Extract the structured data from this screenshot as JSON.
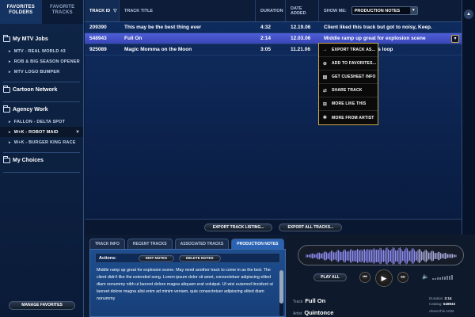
{
  "sidebar": {
    "tabs": [
      {
        "label": "FAVORITES FOLDERS"
      },
      {
        "label": "FAVORITE TRACKS"
      }
    ],
    "groups": [
      {
        "label": "My MTV Jobs",
        "items": [
          "MTV - REAL WORLD #3",
          "ROB & BIG SEASON OPENER",
          "MTV LOGO BUMPER"
        ]
      },
      {
        "label": "Cartoon Network",
        "items": []
      },
      {
        "label": "Agency Work",
        "items": [
          "FALLON - DELTA SPOT",
          "W+K - ROBOT MAID",
          "W+K - BURGER KING RACE"
        ]
      },
      {
        "label": "My Choices",
        "items": []
      }
    ],
    "selected_item_close": "×",
    "manage_label": "MANAGE FAVORITES"
  },
  "tracklist": {
    "columns": {
      "id": "TRACK ID",
      "sort_arrow": "▽",
      "title": "TRACK TITLE",
      "duration": "DURATION",
      "date": "DATE ADDED",
      "show_me": "SHOW ME:",
      "show_me_value": "PRODUCTION NOTES"
    },
    "rows": [
      {
        "id": "209390",
        "title": "This may be the best thing ever",
        "duration": "4:32",
        "date": "12.19.06",
        "notes": "Client liked this track but got to noisy, Keep."
      },
      {
        "id": "548943",
        "title": "Full On",
        "duration": "2:14",
        "date": "12.03.06",
        "notes": "Middle ramp up great for explosion scene"
      },
      {
        "id": "925089",
        "title": "Magic Momma on the Moon",
        "duration": "3:05",
        "date": "11.21.06",
        "notes": "Possibly for the credits loop"
      }
    ],
    "selected_index": 1
  },
  "context_menu": [
    {
      "icon": "arrow-right-icon",
      "glyph": "→",
      "label": "EXPORT TRACK AS..."
    },
    {
      "icon": "add-icon",
      "glyph": "⊕",
      "label": "ADD TO FAVORITES..."
    },
    {
      "icon": "document-icon",
      "glyph": "▤",
      "label": "GET CUESHEET INFO"
    },
    {
      "icon": "share-icon",
      "glyph": "⇄",
      "label": "SHARE TRACK"
    },
    {
      "icon": "similar-icon",
      "glyph": "⊞",
      "label": "MORE LIKE THIS"
    },
    {
      "icon": "artist-icon",
      "glyph": "✱",
      "label": "MORE FROM ARTIST"
    }
  ],
  "export": {
    "listing": "EXPORT TRACK LISTING...",
    "all": "EXPORT ALL TRACKS..."
  },
  "detail": {
    "tabs": [
      "TRACK INFO",
      "RECENT TRACKS",
      "ASSOCIATED TRACKS",
      "PRODUCTION NOTES"
    ],
    "active_tab": 3,
    "actions_label": "Actions:",
    "edit_notes": "EDIT NOTES",
    "delete_notes": "DELETE NOTES",
    "notes_text": "Middle ramp up great for explosion scene. May need another track to come in as the bed. The client didn't like the extended song. Lorem ipsum dolor sit amet, consectetuer adipiscing elited diam nonummy nibh ut laoreet dolore magna aliquam erat volutpat. Ut wisi euismod tincidunt ut laoreet dolore magna alisi enim ad minim veniam, quis consectetuer adipiscing elited diam nonummy"
  },
  "player": {
    "play_all": "PLAY ALL",
    "track_label": "Track",
    "track_value": "Full On",
    "artist_label": "Artist",
    "artist_value": "Quintonce",
    "duration_label": "Duration:",
    "duration_value": "2:14",
    "catalog_label": "Catalog:",
    "catalog_value": "548943",
    "about_label": "About this Artist"
  }
}
